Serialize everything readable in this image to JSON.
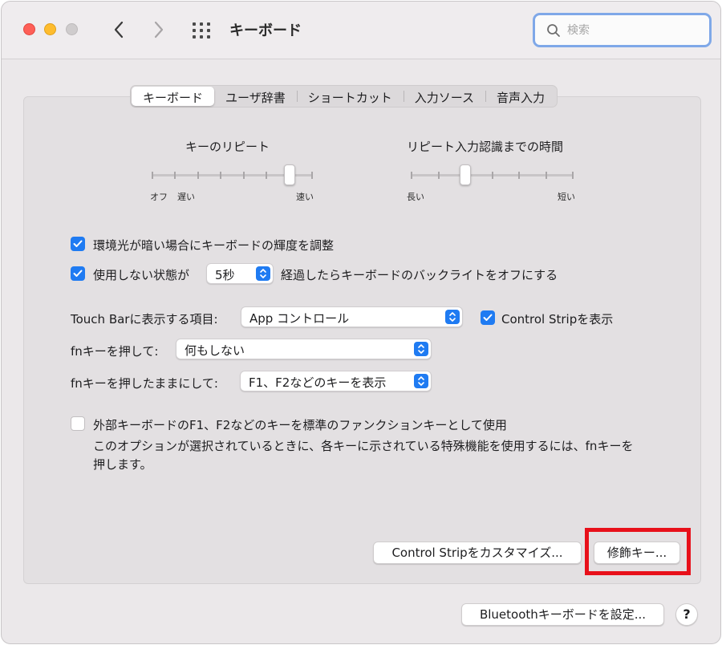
{
  "window": {
    "title": "キーボード"
  },
  "search": {
    "placeholder": "検索",
    "value": ""
  },
  "tabs": [
    {
      "label": "キーボード",
      "selected": true
    },
    {
      "label": "ユーザ辞書",
      "selected": false
    },
    {
      "label": "ショートカット",
      "selected": false
    },
    {
      "label": "入力ソース",
      "selected": false
    },
    {
      "label": "音声入力",
      "selected": false
    }
  ],
  "key_repeat": {
    "title": "キーのリピート",
    "label_off": "オフ",
    "label_slow": "遅い",
    "label_fast": "速い",
    "steps": 8,
    "value_step": 6
  },
  "repeat_delay": {
    "title": "リピート入力認識までの時間",
    "label_long": "長い",
    "label_short": "短い",
    "steps": 7,
    "value_step": 2
  },
  "options": {
    "auto_brightness": {
      "label": "環境光が暗い場合にキーボードの輝度を調整",
      "checked": true
    },
    "backlight_off": {
      "label_before": "使用しない状態が",
      "select_value": "5秒",
      "label_after": "経過したらキーボードのバックライトをオフにする",
      "checked": true
    }
  },
  "touchbar": {
    "label": "Touch Barに表示する項目:",
    "value": "App コントロール",
    "show_control_strip": {
      "label": "Control Stripを表示",
      "checked": true
    }
  },
  "fn_press": {
    "label": "fnキーを押して:",
    "value": "何もしない"
  },
  "fn_hold": {
    "label": "fnキーを押したままにして:",
    "value": "F1、F2などのキーを表示"
  },
  "function_keys": {
    "label": "外部キーボードのF1、F2などのキーを標準のファンクションキーとして使用",
    "checked": false,
    "desc_line1": "このオプションが選択されているときに、各キーに示されている特殊機能を使用するには、fnキーを",
    "desc_line2": "押します。"
  },
  "buttons": {
    "customize_control_strip": "Control Stripをカスタマイズ...",
    "modifier_keys": "修飾キー...",
    "bluetooth_keyboard": "Bluetoothキーボードを設定...",
    "help": "?"
  },
  "colors": {
    "accent": "#1f7bf2",
    "highlight": "#e8101a"
  }
}
